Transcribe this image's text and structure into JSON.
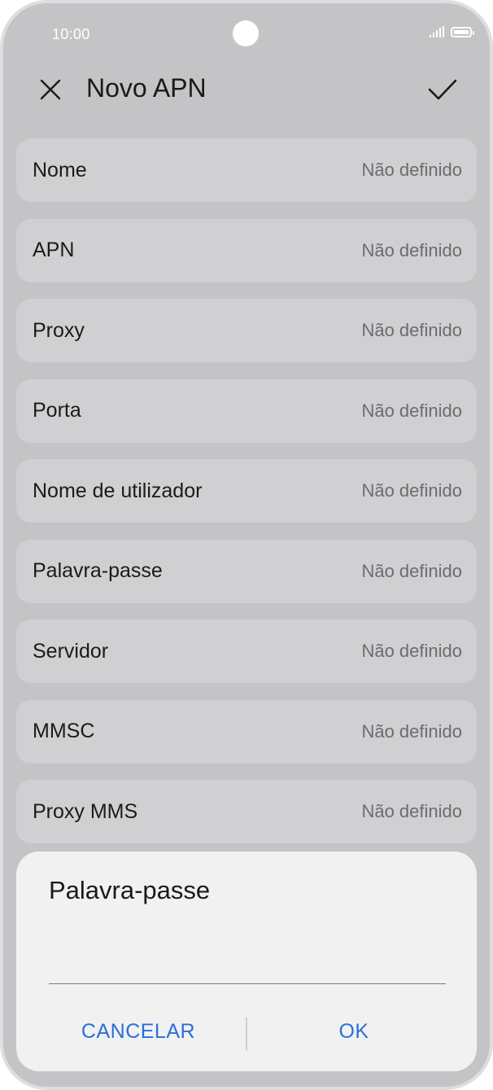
{
  "status_bar": {
    "time": "10:00"
  },
  "app_bar": {
    "title": "Novo APN",
    "close_icon": "close-icon",
    "confirm_icon": "check-icon"
  },
  "fields": [
    {
      "label": "Nome",
      "value": "Não definido"
    },
    {
      "label": "APN",
      "value": "Não definido"
    },
    {
      "label": "Proxy",
      "value": "Não definido"
    },
    {
      "label": "Porta",
      "value": "Não definido"
    },
    {
      "label": "Nome de utilizador",
      "value": "Não definido"
    },
    {
      "label": "Palavra-passe",
      "value": "Não definido"
    },
    {
      "label": "Servidor",
      "value": "Não definido"
    },
    {
      "label": "MMSC",
      "value": "Não definido"
    },
    {
      "label": "Proxy MMS",
      "value": "Não definido"
    }
  ],
  "dialog": {
    "title": "Palavra-passe",
    "input_value": "",
    "cancel_label": "CANCELAR",
    "ok_label": "OK"
  },
  "colors": {
    "accent": "#2b6fd8",
    "scrim_background": "#c4c4c6",
    "dialog_background": "#f1f1f1"
  }
}
